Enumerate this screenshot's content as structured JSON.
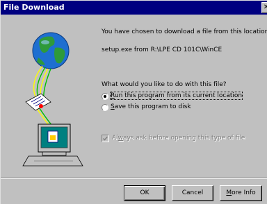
{
  "window": {
    "title": "File Download",
    "close_glyph": "✕"
  },
  "message": {
    "line1": "You have chosen to download a file from this location.",
    "source": "setup.exe from R:\\LPE CD 101C\\WinCE",
    "question": "What would you like to do with this file?"
  },
  "options": [
    {
      "accel": "R",
      "rest": "un this program from its current location",
      "selected": true
    },
    {
      "accel": "S",
      "rest": "ave this program to disk",
      "selected": false
    }
  ],
  "always_ask": {
    "pre": "Al",
    "accel": "w",
    "rest": "ays ask before opening this type of file",
    "checked": true,
    "enabled": false
  },
  "buttons": {
    "ok": "OK",
    "cancel": "Cancel",
    "more_accel": "M",
    "more_rest": "ore Info"
  },
  "icons": [
    "globe-icon",
    "document-icon",
    "computer-icon"
  ]
}
